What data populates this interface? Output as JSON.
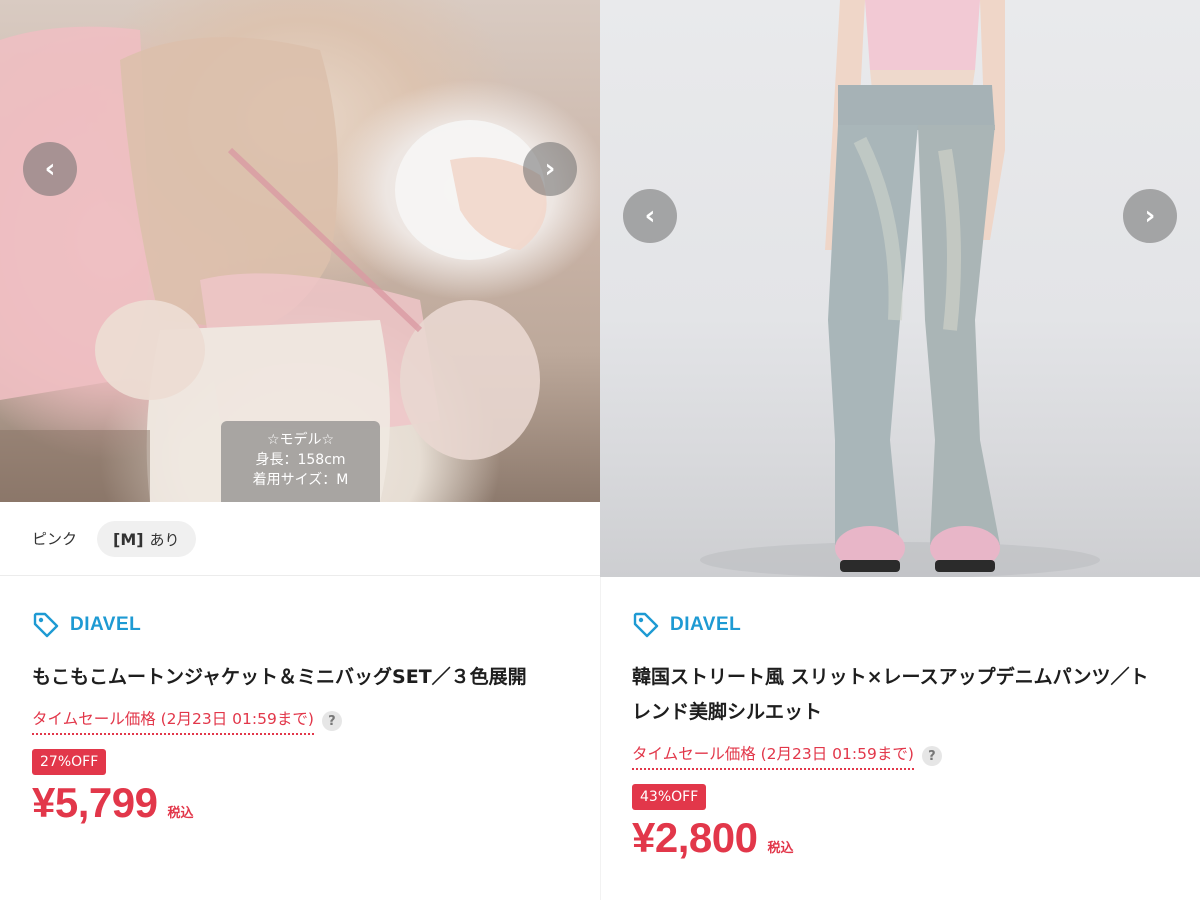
{
  "products": [
    {
      "photo_overlay": {
        "line1": "☆モデル☆",
        "line2": "身長：158cm",
        "line3": "着用サイズ：M"
      },
      "variant": {
        "color": "ピンク",
        "size": "[M]",
        "stock": "あり"
      },
      "brand": "DIAVEL",
      "title": "もこもこムートンジャケット＆ミニバッグSET／３色展開",
      "sale_label": "タイムセール価格 (2月23日 01:59まで)",
      "discount": "27%OFF",
      "price": "¥5,799",
      "tax_label": "税込"
    },
    {
      "brand": "DIAVEL",
      "title": "韓国ストリート風 スリット×レースアップデニムパンツ／トレンド美脚シルエット",
      "sale_label": "タイムセール価格 (2月23日 01:59まで)",
      "discount": "43%OFF",
      "price": "¥2,800",
      "tax_label": "税込"
    }
  ],
  "controls": {
    "prev_glyph": "‹",
    "next_glyph": "›",
    "help_glyph": "?"
  },
  "icons": {
    "tag": "tag-icon",
    "prev": "chevron-left-icon",
    "next": "chevron-right-icon",
    "help": "help-icon"
  },
  "colors": {
    "brand": "#1e9ad3",
    "sale": "#e2374a"
  }
}
